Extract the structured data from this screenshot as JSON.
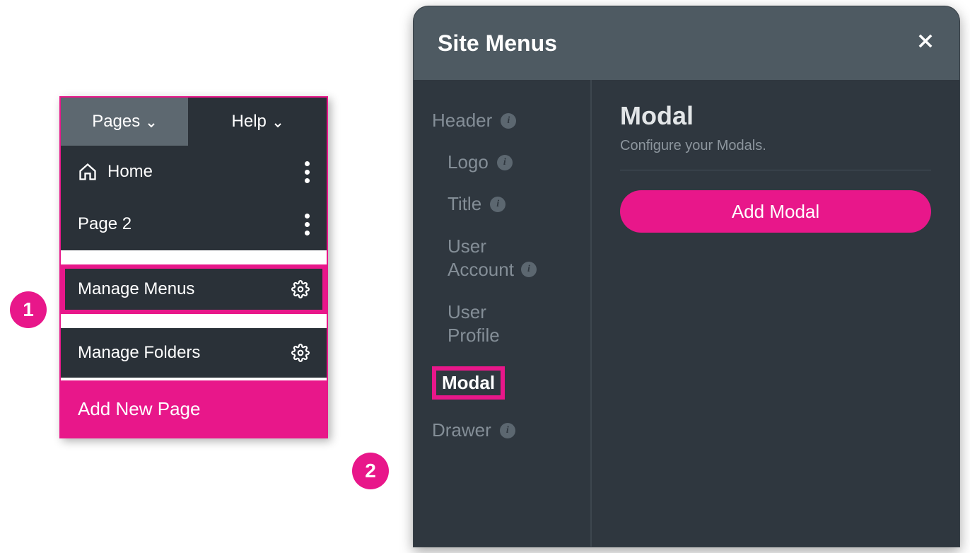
{
  "colors": {
    "accent": "#e8178a",
    "panel_bg": "#2a3138",
    "modal_bg": "#2f373f",
    "header_bg": "#4e5a62",
    "muted_text": "#848e97"
  },
  "callouts": {
    "badge1": "1",
    "badge2": "2"
  },
  "left_dropdown": {
    "tabs": {
      "pages": "Pages",
      "help": "Help"
    },
    "pages": [
      {
        "label": "Home",
        "icon": "home-icon"
      },
      {
        "label": "Page 2"
      }
    ],
    "manage_menus": "Manage Menus",
    "manage_folders": "Manage Folders",
    "add_new_page": "Add New Page"
  },
  "site_menus_modal": {
    "title": "Site Menus",
    "sidebar": {
      "header": "Header",
      "header_children": [
        {
          "label": "Logo",
          "info": true
        },
        {
          "label": "Title",
          "info": true
        },
        {
          "label_line1": "User",
          "label_line2": "Account",
          "info": true
        },
        {
          "label_line1": "User",
          "label_line2": "Profile",
          "info": false
        }
      ],
      "modal": "Modal",
      "drawer": "Drawer"
    },
    "content": {
      "title": "Modal",
      "subtitle": "Configure your Modals.",
      "button": "Add Modal"
    }
  }
}
